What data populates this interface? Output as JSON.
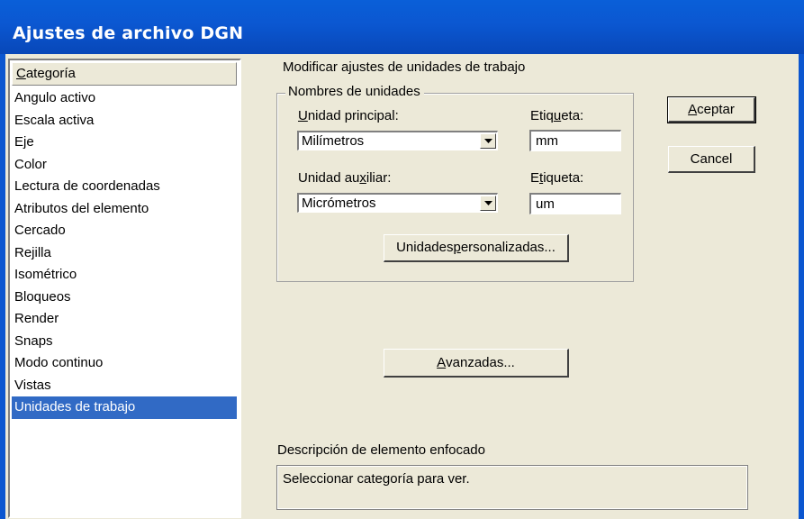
{
  "window": {
    "title": "Ajustes de archivo DGN"
  },
  "category_list": {
    "header_prefix": "C",
    "header_rest": "ategoría",
    "items": [
      "Angulo activo",
      "Escala activa",
      "Eje",
      "Color",
      "Lectura de coordenadas",
      "Atributos del elemento",
      "Cercado",
      "Rejilla",
      "Isométrico",
      "Bloqueos",
      "Render",
      "Snaps",
      "Modo continuo",
      "Vistas",
      "Unidades de trabajo"
    ],
    "selected": "Unidades de trabajo"
  },
  "settings": {
    "heading": "Modificar ajustes de unidades de trabajo",
    "group_title": "Nombres de unidades",
    "principal": {
      "label_pre": "",
      "label_u": "U",
      "label_post": "nidad principal:",
      "value": "Milímetros",
      "tag_label_pre": "Etiq",
      "tag_label_u": "u",
      "tag_label_post": "eta:",
      "tag_value": "mm"
    },
    "auxiliar": {
      "label_pre": "Unidad au",
      "label_u": "x",
      "label_post": "iliar:",
      "value": "Micrómetros",
      "tag_label_pre": "E",
      "tag_label_u": "t",
      "tag_label_post": "iqueta:",
      "tag_value": "um"
    },
    "custom_button": {
      "pre": "Unidades ",
      "u": "p",
      "post": "ersonalizadas..."
    },
    "advanced_button": {
      "pre": "",
      "u": "A",
      "post": "vanzadas..."
    }
  },
  "buttons": {
    "accept": {
      "pre": "",
      "u": "A",
      "post": "ceptar"
    },
    "cancel": "Cancel"
  },
  "description": {
    "label": "Descripción de elemento enfocado",
    "text": "Seleccionar categoría para ver."
  }
}
